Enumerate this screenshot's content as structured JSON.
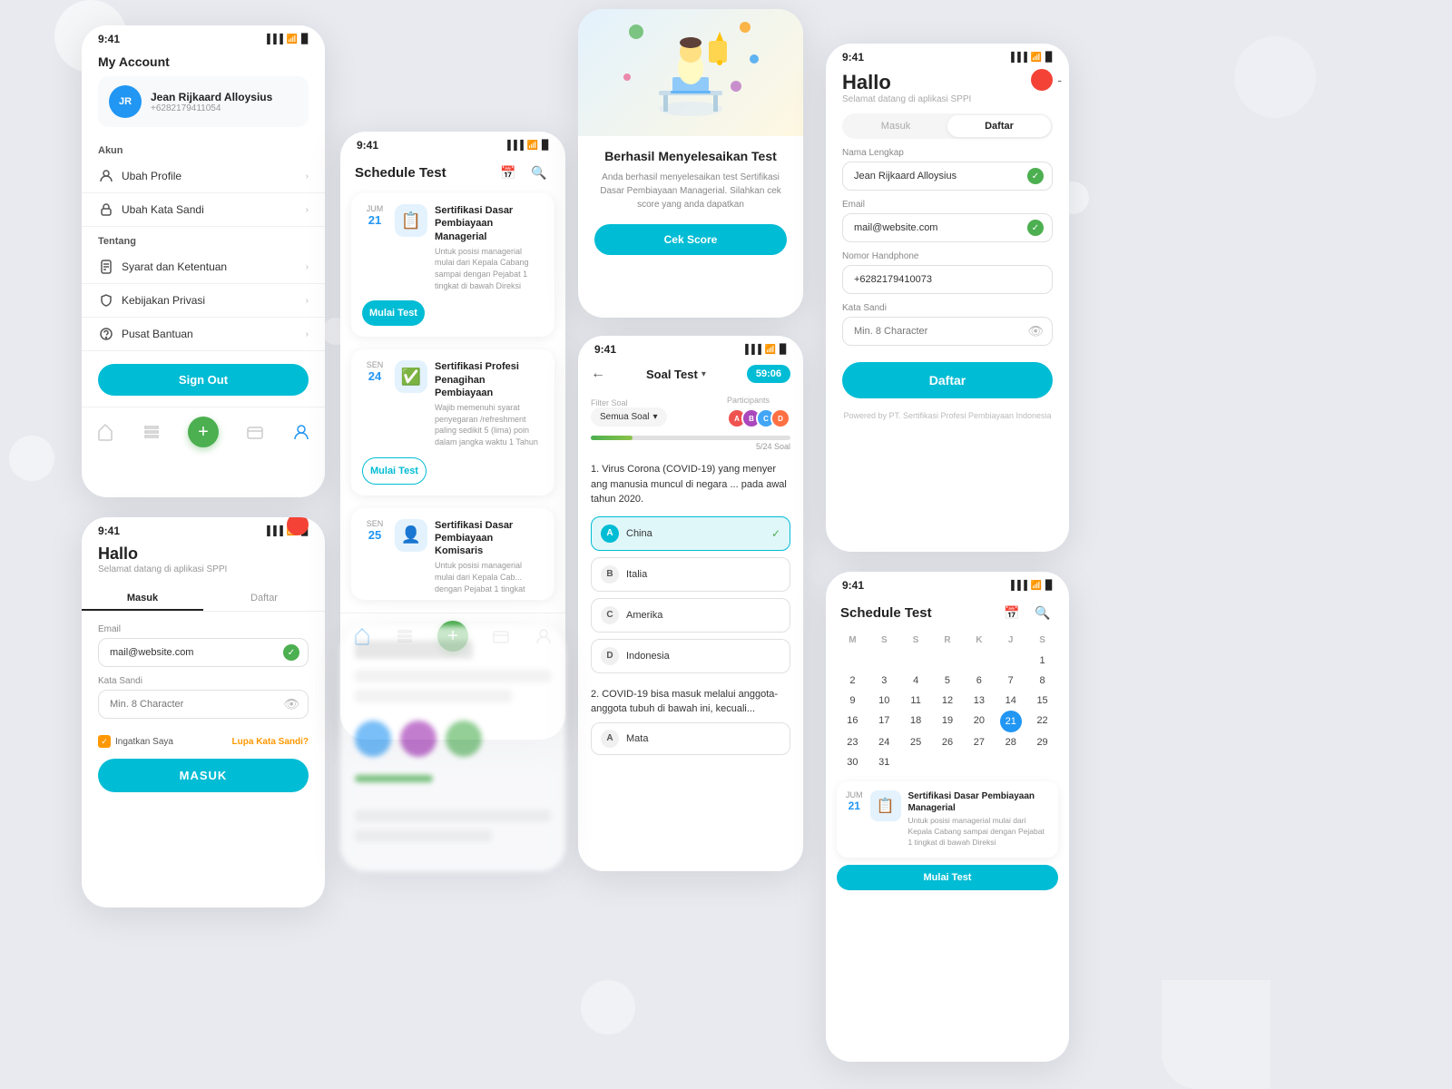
{
  "app": {
    "name": "SPPI",
    "background_color": "#e8eaf0"
  },
  "card_account": {
    "status_time": "9:41",
    "title": "My Account",
    "user": {
      "initials": "JR",
      "name": "Jean Rijkaard Alloysius",
      "phone": "+6282179411054"
    },
    "sections": {
      "akun_label": "Akun",
      "menu_items": [
        {
          "icon": "profile-icon",
          "label": "Ubah Profile"
        },
        {
          "icon": "lock-icon",
          "label": "Ubah Kata Sandi"
        }
      ],
      "tentang_label": "Tentang",
      "tentang_items": [
        {
          "icon": "document-icon",
          "label": "Syarat dan Ketentuan"
        },
        {
          "icon": "shield-icon",
          "label": "Kebijakan Privasi"
        },
        {
          "icon": "help-icon",
          "label": "Pusat Bantuan"
        }
      ]
    },
    "signout_label": "Sign Out",
    "nav": [
      "home-icon",
      "list-icon",
      "add-icon",
      "card-icon",
      "person-icon"
    ]
  },
  "card_login_small": {
    "status_time": "9:41",
    "greeting": "Hallo",
    "subtitle": "Selamat datang di aplikasi SPPI",
    "tabs": [
      "Masuk",
      "Daftar"
    ],
    "active_tab": "Masuk",
    "email_label": "Email",
    "email_value": "mail@website.com",
    "password_label": "Kata Sandi",
    "password_placeholder": "Min. 8 Character",
    "remember_label": "Ingatkan Saya",
    "forgot_label": "Lupa Kata Sandi?",
    "submit_label": "MASUK"
  },
  "card_schedule": {
    "status_time": "9:41",
    "title": "Schedule Test",
    "tests": [
      {
        "date_abbr": "JUM",
        "date_num": "21",
        "icon": "📋",
        "name": "Sertifikasi Dasar Pembiayaan Managerial",
        "desc": "Untuk posisi managerial mulai dari Kepala Cabang sampai dengan Pejabat 1 tingkat di bawah Direksi",
        "btn_label": "Mulai Test",
        "btn_type": "primary"
      },
      {
        "date_abbr": "SEN",
        "date_num": "24",
        "icon": "✅",
        "name": "Sertifikasi Profesi Penagihan Pembiayaan",
        "desc": "Wajib memenuhi syarat penyegaran /refreshment paling sedikit 5 (lima) poin dalam jangka waktu 1 Tahun",
        "btn_label": "Mulai Test",
        "btn_type": "outline"
      },
      {
        "date_abbr": "SEN",
        "date_num": "25",
        "icon": "👤",
        "name": "Sertifikasi Dasar Pembiayaan Komisaris",
        "desc": "Untuk posisi managerial mulai dari Kepala Cab... dengan Pejabat 1 tingkat",
        "btn_label": "",
        "btn_type": ""
      }
    ]
  },
  "card_completed": {
    "title": "Berhasil Menyelesaikan Test",
    "desc": "Anda berhasil menyelesaikan test Sertifikasi Dasar Pembiayaan Managerial. Silahkan cek score yang anda dapatkan",
    "btn_label": "Cek Score"
  },
  "card_soal": {
    "status_time": "9:41",
    "back": "←",
    "title": "Soal Test",
    "timer": "59:06",
    "filter_label": "Filter Soal",
    "filter_value": "Semua Soal",
    "participants_label": "Participants",
    "progress_text": "5/24 Soal",
    "questions": [
      {
        "num": "1.",
        "text": "Virus Corona (COVID-19) yang menyer ang manusia muncul di negara ... pada awal tahun 2020.",
        "options": [
          {
            "letter": "A",
            "text": "China",
            "correct": true
          },
          {
            "letter": "B",
            "text": "Italia",
            "correct": false
          },
          {
            "letter": "C",
            "text": "Amerika",
            "correct": false
          },
          {
            "letter": "D",
            "text": "Indonesia",
            "correct": false
          }
        ]
      },
      {
        "num": "2.",
        "text": "COVID-19 bisa masuk melalui anggota-anggota tubuh di bawah ini, kecuali...",
        "options": [
          {
            "letter": "A",
            "text": "Mata",
            "correct": false
          }
        ]
      }
    ]
  },
  "card_register": {
    "status_time": "9:41",
    "greeting": "Hallo",
    "subtitle": "Selamat datang di aplikasi SPPI",
    "tabs": [
      "Masuk",
      "Daftar"
    ],
    "active_tab": "Daftar",
    "fields": [
      {
        "label": "Nama Lengkap",
        "value": "Jean Rijkaard Alloysius",
        "has_check": true
      },
      {
        "label": "Email",
        "value": "mail@website.com",
        "has_check": true
      },
      {
        "label": "Nomor Handphone",
        "value": "+6282179410073",
        "has_check": false
      },
      {
        "label": "Kata Sandi",
        "value": "Min. 8 Character",
        "has_check": false,
        "has_eye": true
      }
    ],
    "submit_label": "Daftar",
    "powered_by": "Powered by PT. Sertifikasi Profesi Pembiayaan Indonesia"
  },
  "card_calendar": {
    "status_time": "9:41",
    "title": "Schedule Test",
    "days": [
      "M",
      "S",
      "S",
      "R",
      "K",
      "J",
      "S"
    ],
    "weeks": [
      [
        null,
        null,
        null,
        null,
        null,
        null,
        "1"
      ],
      [
        "2",
        "3",
        "4",
        "5",
        "6",
        "7",
        "8"
      ],
      [
        "9",
        "10",
        "11",
        "12",
        "13",
        "14",
        "15"
      ],
      [
        "16",
        "17",
        "18",
        "19",
        "20",
        "21",
        "22"
      ],
      [
        "23",
        "24",
        "25",
        "26",
        "27",
        "28",
        "29"
      ],
      [
        "30",
        "31",
        null,
        null,
        null,
        null,
        null
      ]
    ],
    "today": "21",
    "event": {
      "date_abbr": "JUM",
      "date_num": "21",
      "icon": "📋",
      "name": "Sertifikasi Dasar Pembiayaan Managerial",
      "desc": "Untuk posisi managerial mulai dari Kepala Cabang sampai dengan Pejabat 1 tingkat di bawah Direksi",
      "btn_label": "Mulai Test"
    }
  }
}
